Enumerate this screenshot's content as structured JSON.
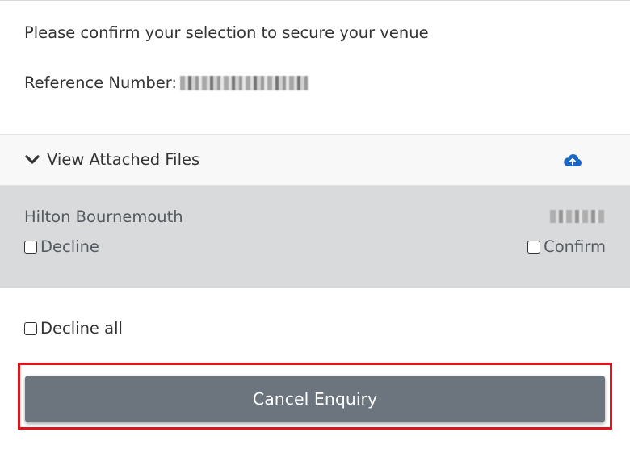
{
  "intro": {
    "confirm_text": "Please confirm your selection to secure your venue",
    "reference_label": "Reference Number:"
  },
  "files": {
    "toggle_label": "View Attached Files",
    "toggle_icon": "chevron-down-icon",
    "upload_icon": "cloud-upload-icon",
    "accent_color": "#1a66c4"
  },
  "venue": {
    "name": "Hilton Bournemouth",
    "decline_label": "Decline",
    "confirm_label": "Confirm"
  },
  "footer": {
    "decline_all_label": "Decline all",
    "cancel_label": "Cancel Enquiry",
    "cancel_color": "#6c757d",
    "highlight_color": "#e0141c"
  }
}
